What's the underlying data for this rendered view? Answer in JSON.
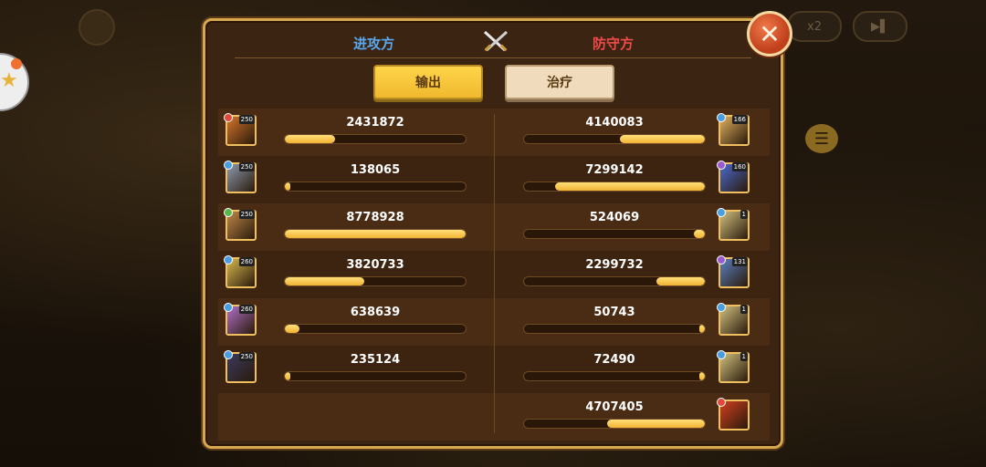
{
  "header": {
    "attacker_label": "进攻方",
    "defender_label": "防守方"
  },
  "tabs": [
    {
      "label": "输出",
      "active": true
    },
    {
      "label": "治疗",
      "active": false
    }
  ],
  "background": {
    "speed_label": "x2"
  },
  "attackers": [
    {
      "value": "2431872",
      "fraction": 0.28,
      "level": "250",
      "faction_color": "#e04a3a",
      "avatar_color": "#d4742a"
    },
    {
      "value": "138065",
      "fraction": 0.02,
      "level": "250",
      "faction_color": "#4a9de0",
      "avatar_color": "#8e9ab0"
    },
    {
      "value": "8778928",
      "fraction": 1.0,
      "level": "250",
      "faction_color": "#5ab84a",
      "avatar_color": "#c0884a"
    },
    {
      "value": "3820733",
      "fraction": 0.44,
      "level": "260",
      "faction_color": "#4a9de0",
      "avatar_color": "#d8b850"
    },
    {
      "value": "638639",
      "fraction": 0.08,
      "level": "260",
      "faction_color": "#4a9de0",
      "avatar_color": "#b070c8"
    },
    {
      "value": "235124",
      "fraction": 0.03,
      "level": "250",
      "faction_color": "#4a9de0",
      "avatar_color": "#3a3a60"
    }
  ],
  "defenders": [
    {
      "value": "4140083",
      "fraction": 0.47,
      "level": "166",
      "faction_color": "#4a9de0",
      "avatar_color": "#e0b060"
    },
    {
      "value": "7299142",
      "fraction": 0.83,
      "level": "160",
      "faction_color": "#9a5ad0",
      "avatar_color": "#4a6ad0"
    },
    {
      "value": "524069",
      "fraction": 0.06,
      "level": "1",
      "faction_color": "#4a9de0",
      "avatar_color": "#d0c080"
    },
    {
      "value": "2299732",
      "fraction": 0.27,
      "level": "131",
      "faction_color": "#9a5ad0",
      "avatar_color": "#5a80c0"
    },
    {
      "value": "50743",
      "fraction": 0.01,
      "level": "1",
      "faction_color": "#4a9de0",
      "avatar_color": "#d0c080"
    },
    {
      "value": "72490",
      "fraction": 0.01,
      "level": "1",
      "faction_color": "#4a9de0",
      "avatar_color": "#d0c080"
    },
    {
      "value": "4707405",
      "fraction": 0.54,
      "level": "",
      "faction_color": "#e04a3a",
      "avatar_color": "#d04020"
    }
  ]
}
